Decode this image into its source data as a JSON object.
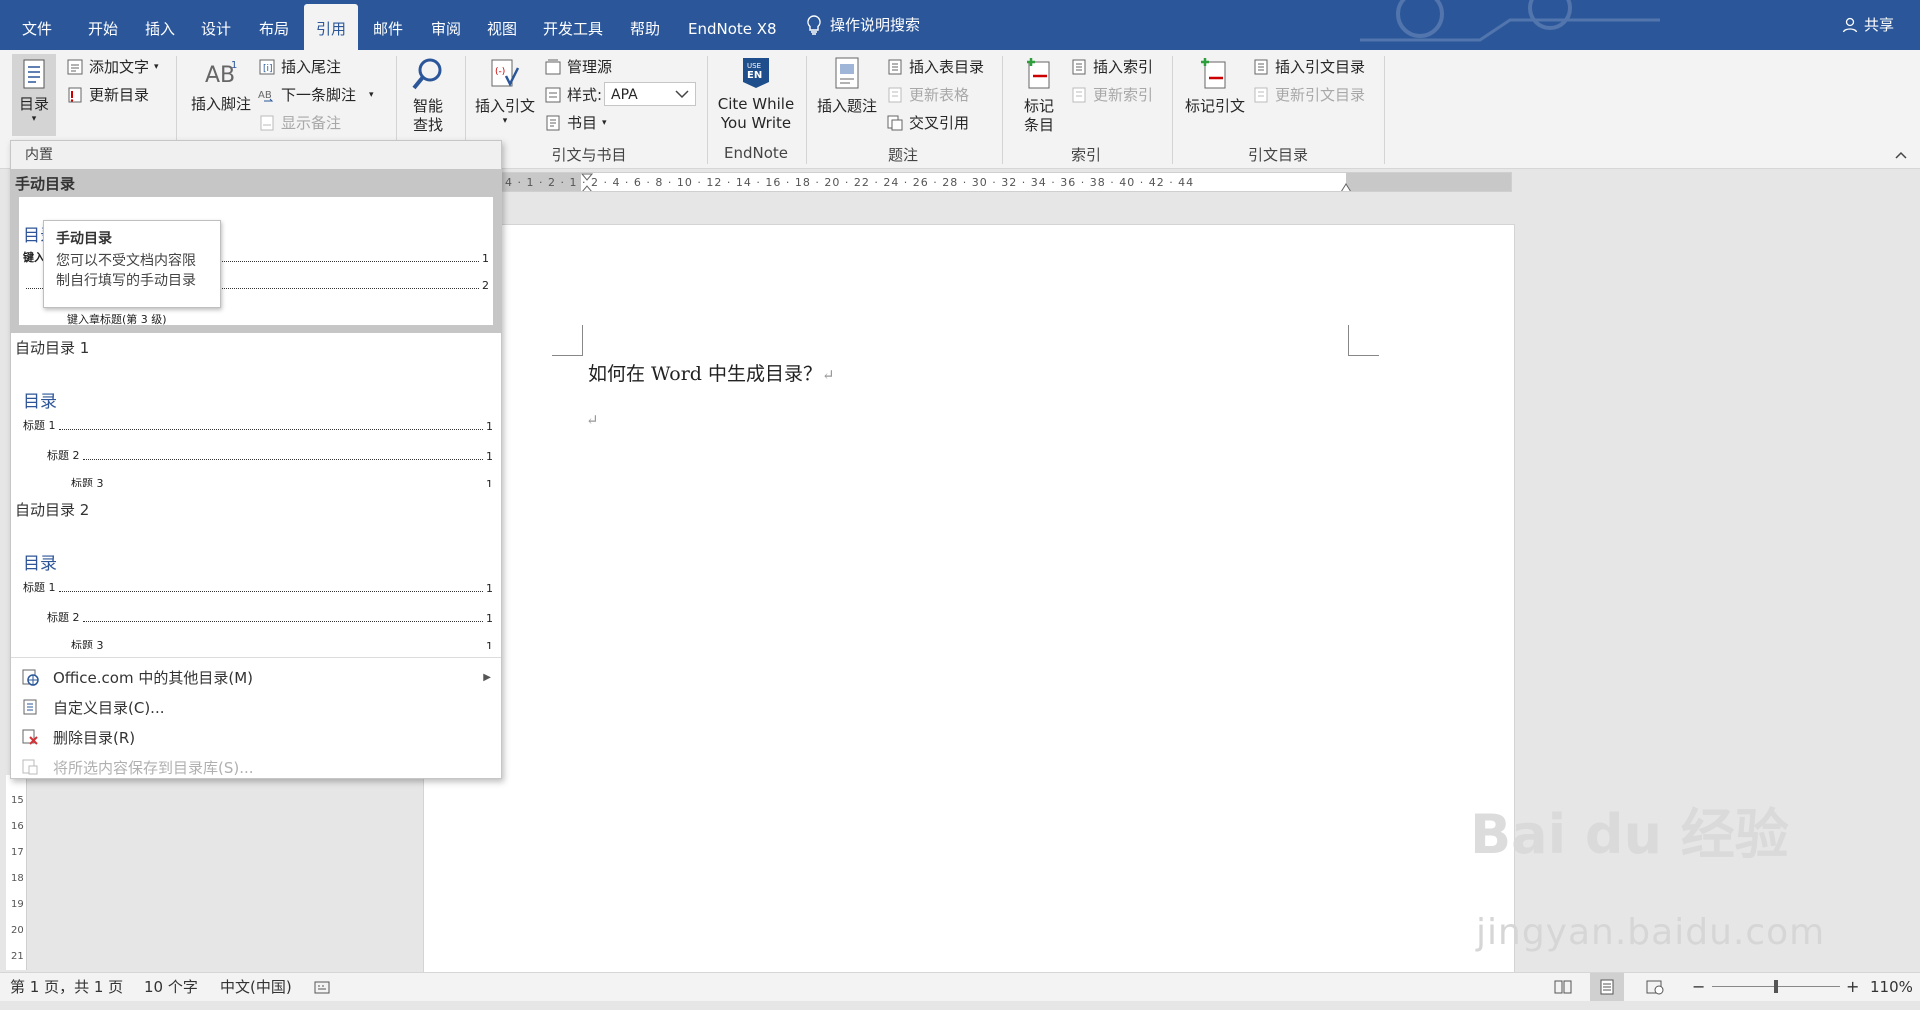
{
  "menubar": {
    "tabs": [
      "文件",
      "开始",
      "插入",
      "设计",
      "布局",
      "引用",
      "邮件",
      "审阅",
      "视图",
      "开发工具",
      "帮助",
      "EndNote X8"
    ],
    "active_tab": "引用",
    "search_label": "操作说明搜索",
    "share_label": "共享"
  },
  "ribbon": {
    "toc": {
      "button": "目录",
      "add_text": "添加文字",
      "update_toc": "更新目录"
    },
    "footnotes": {
      "insert_footnote": "插入脚注",
      "insert_endnote": "插入尾注",
      "next_footnote": "下一条脚注",
      "show_notes": "显示备注"
    },
    "research": {
      "smart_lookup_1": "智能",
      "smart_lookup_2": "查找"
    },
    "citations": {
      "insert_citation": "插入引文",
      "manage_sources": "管理源",
      "style_label": "样式:",
      "style_value": "APA",
      "bibliography": "书目",
      "group_label": "引文与书目"
    },
    "endnote": {
      "cite_1": "Cite While",
      "cite_2": "You Write",
      "group_label": "EndNote"
    },
    "captions": {
      "insert_caption": "插入题注",
      "insert_table_figures": "插入表目录",
      "update_table": "更新表格",
      "cross_reference": "交叉引用",
      "group_label": "题注"
    },
    "index": {
      "mark_entry_1": "标记",
      "mark_entry_2": "条目",
      "insert_index": "插入索引",
      "update_index": "更新索引",
      "group_label": "索引"
    },
    "authorities": {
      "mark_citation": "标记引文",
      "insert_authorities": "插入引文目录",
      "update_authorities": "更新引文目录",
      "group_label": "引文目录"
    }
  },
  "dropdown": {
    "header": "内置",
    "manual_label": "手动目录",
    "manual_title": "目录",
    "manual_rows": [
      "键入",
      "",
      "键入章标题(第 3 级)"
    ],
    "auto1_label": "自动目录 1",
    "auto2_label": "自动目录 2",
    "toc_title": "目录",
    "toc_rows": [
      {
        "text": "标题 1",
        "page": "1"
      },
      {
        "text": "标题 2",
        "page": "1"
      },
      {
        "text": "标题 3",
        "page": "1"
      }
    ],
    "tooltip_title": "手动目录",
    "tooltip_body_1": "您可以不受文档内容限",
    "tooltip_body_2": "制自行填写的手动目录",
    "menu": {
      "office_more": "Office.com 中的其他目录(M)",
      "custom_toc": "自定义目录(C)...",
      "remove_toc": "删除目录(R)",
      "save_selection": "将所选内容保存到目录库(S)..."
    }
  },
  "ruler": {
    "ticks": "4 · 1 · 2 · 1 · 2 · 4 · 6 · 8 · 10 · 12 · 14 · 16 · 18 · 20 · 22 · 24 · 26 · 28 · 30 · 32 · 34 · 36 · 38 · 40 · 42 · 44",
    "vertical": [
      "15",
      "16",
      "17",
      "18",
      "19",
      "20",
      "21"
    ]
  },
  "document": {
    "line1": "如何在 Word 中生成目录？"
  },
  "statusbar": {
    "page": "第 1 页，共 1 页",
    "words": "10 个字",
    "language": "中文(中国)",
    "zoom": "110%",
    "zoom_minus": "−",
    "zoom_plus": "+"
  },
  "watermark": {
    "brand": "Bai du 经验",
    "url": "jingyan.baidu.com"
  }
}
